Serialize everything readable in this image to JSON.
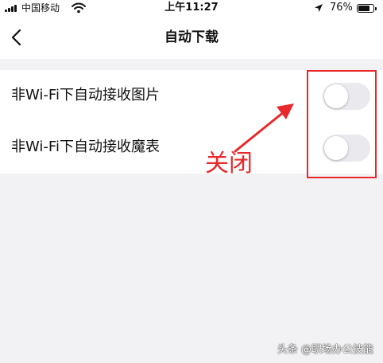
{
  "status_bar": {
    "carrier": "中国移动",
    "time": "上午11:27",
    "battery_percent": "76%",
    "battery_level": 0.76,
    "icons": [
      "signal-icon",
      "wifi-icon",
      "location-arrow-icon",
      "battery-icon"
    ]
  },
  "nav": {
    "back_icon": "chevron-left-icon",
    "title": "自动下载"
  },
  "settings": [
    {
      "label": "非Wi-Fi下自动接收图片",
      "enabled": false
    },
    {
      "label": "非Wi-Fi下自动接收魔表",
      "enabled": false
    }
  ],
  "annotation": {
    "text": "关闭",
    "color": "#e8282b"
  },
  "watermark": "头条 @职场办公技能",
  "colors": {
    "toggle_off": "#e9e9ee",
    "page_background": "#f2f2f4",
    "annotation_red": "#e8282b"
  }
}
